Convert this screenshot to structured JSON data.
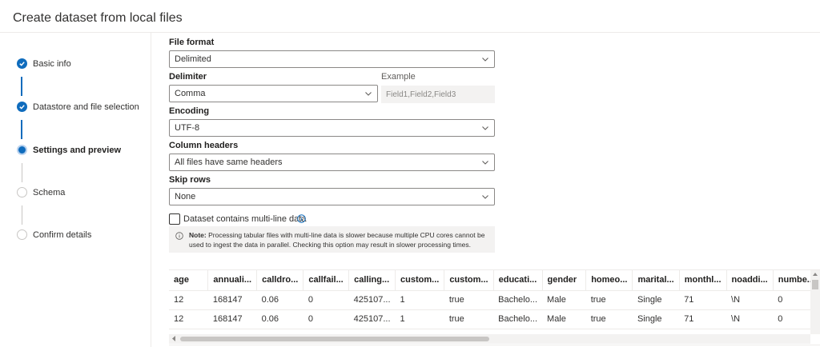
{
  "dialog": {
    "title": "Create dataset from local files"
  },
  "steps": [
    {
      "label": "Basic info",
      "state": "done"
    },
    {
      "label": "Datastore and file selection",
      "state": "done"
    },
    {
      "label": "Settings and preview",
      "state": "current"
    },
    {
      "label": "Schema",
      "state": "pending"
    },
    {
      "label": "Confirm details",
      "state": "pending"
    }
  ],
  "form": {
    "file_format": {
      "label": "File format",
      "value": "Delimited"
    },
    "delimiter": {
      "label": "Delimiter",
      "value": "Comma"
    },
    "example": {
      "label": "Example",
      "value": "Field1,Field2,Field3"
    },
    "encoding": {
      "label": "Encoding",
      "value": "UTF-8"
    },
    "column_headers": {
      "label": "Column headers",
      "value": "All files have same headers"
    },
    "skip_rows": {
      "label": "Skip rows",
      "value": "None"
    },
    "multiline": {
      "label": "Dataset contains multi-line data",
      "checked": false
    },
    "note": {
      "prefix": "Note:",
      "text": " Processing tabular files with multi-line data is slower because multiple CPU cores cannot be used to ingest the data in parallel. Checking this option may result in slower processing times."
    }
  },
  "preview": {
    "headers": [
      "age",
      "annuali...",
      "calldro...",
      "callfail...",
      "calling...",
      "custom...",
      "custom...",
      "educati...",
      "gender",
      "homeo...",
      "marital...",
      "monthl...",
      "noaddi...",
      "numbe..."
    ],
    "rows": [
      [
        "12",
        "168147",
        "0.06",
        "0",
        "425107...",
        "1",
        "true",
        "Bachelo...",
        "Male",
        "true",
        "Single",
        "71",
        "\\N",
        "0"
      ],
      [
        "12",
        "168147",
        "0.06",
        "0",
        "425107...",
        "1",
        "true",
        "Bachelo...",
        "Male",
        "true",
        "Single",
        "71",
        "\\N",
        "0"
      ]
    ]
  },
  "colors": {
    "accent": "#0f6cbd",
    "border": "#8a8886",
    "note_bg": "#f3f2f1"
  },
  "icons": {
    "step_done": "checkmark-icon",
    "select": "chevron-down-icon",
    "info": "info-icon"
  }
}
